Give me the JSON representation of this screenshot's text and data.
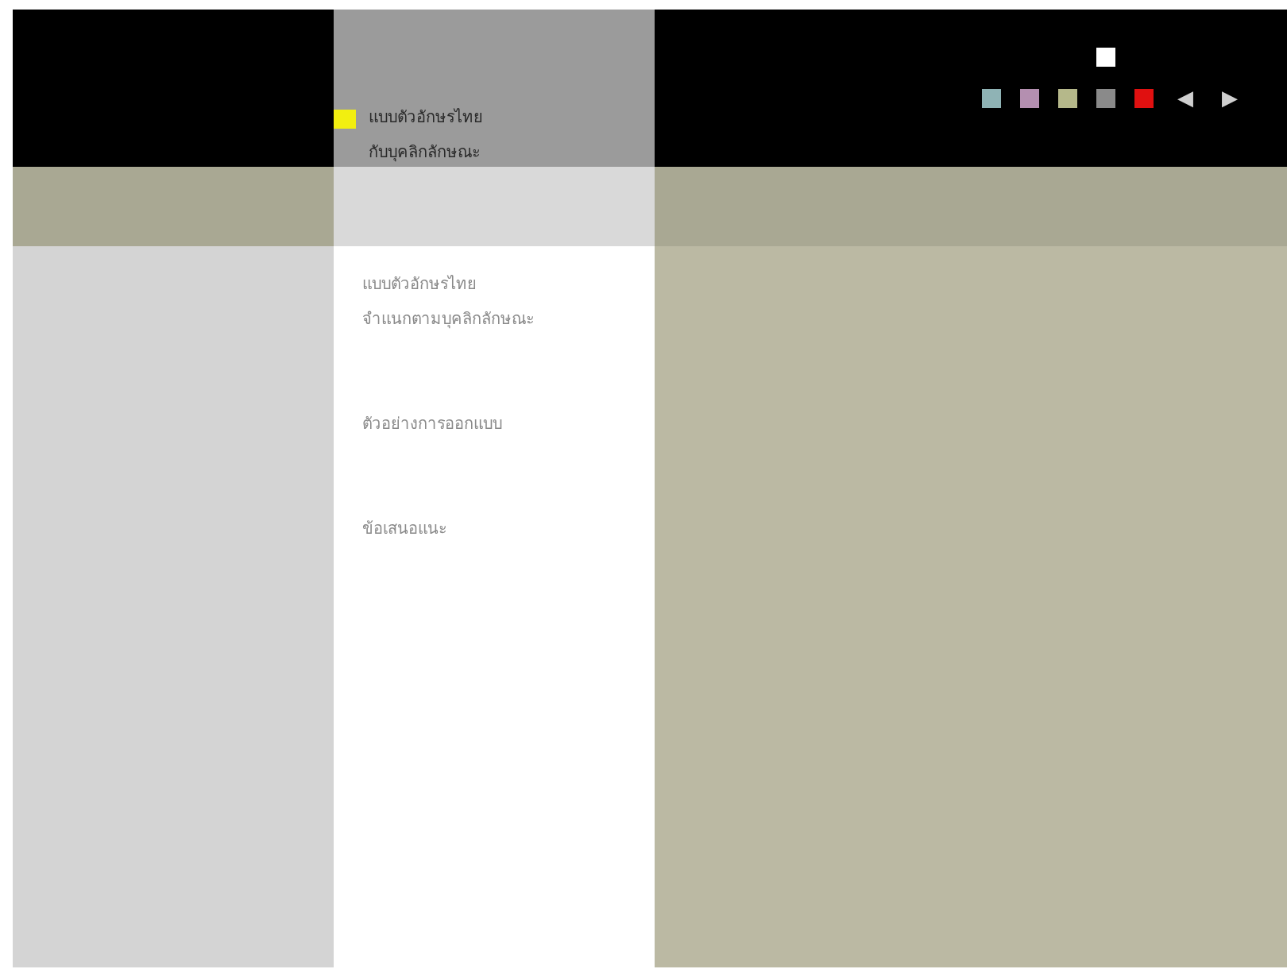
{
  "menu": [
    {
      "label": "แบบตัวอักษรไทย\nกับบุคลิกลักษณะ",
      "selected": true
    },
    {
      "label": "แบบตัวอักษรไทย\nจำแนกตามบุคลิกลักษณะ",
      "selected": false
    },
    {
      "label": "ตัวอย่างการออกแบบ",
      "selected": false
    },
    {
      "label": "ข้อเสนอแนะ",
      "selected": false
    }
  ],
  "swatches": [
    {
      "color": "#8fb3b5",
      "selected": false
    },
    {
      "color": "#b48fb0",
      "selected": false
    },
    {
      "color": "#b5b88a",
      "selected": false
    },
    {
      "color": "#8a8a8a",
      "selected": true
    },
    {
      "color": "#e01010",
      "selected": false
    }
  ],
  "nav": {
    "prev": "◀",
    "next": "▶"
  }
}
